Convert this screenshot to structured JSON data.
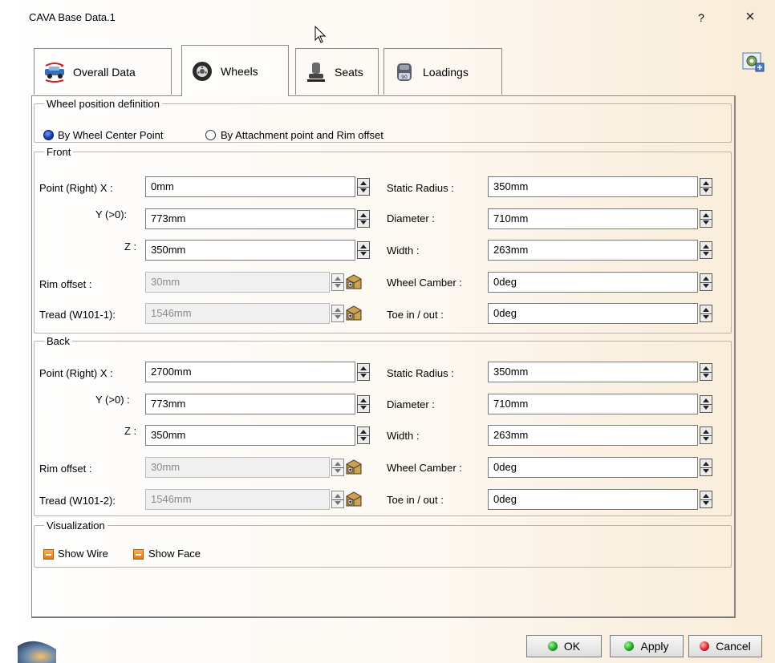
{
  "window": {
    "title": "CAVA Base Data.1",
    "help": "?",
    "close": "×"
  },
  "tabs": [
    {
      "label": "Overall Data",
      "icon": "car-icon"
    },
    {
      "label": "Wheels",
      "icon": "wheel-icon"
    },
    {
      "label": "Seats",
      "icon": "seat-icon"
    },
    {
      "label": "Loadings",
      "icon": "loading-icon"
    }
  ],
  "active_tab": "Wheels",
  "wheel_position": {
    "legend": "Wheel position definition",
    "option1": "By Wheel Center Point",
    "option2": "By Attachment point and Rim offset",
    "selected": "By Wheel Center Point"
  },
  "front": {
    "legend": "Front",
    "labels": {
      "point_x": "Point (Right)  X :",
      "y": "Y (>0):",
      "z": "Z :",
      "rim_offset": "Rim offset :",
      "tread": "Tread (W101-1):",
      "static_radius": "Static Radius :",
      "diameter": "Diameter :",
      "width": "Width :",
      "camber": "Wheel Camber :",
      "toe": "Toe in / out :"
    },
    "values": {
      "x": "0mm",
      "y": "773mm",
      "z": "350mm",
      "rim_offset": "30mm",
      "tread": "1546mm",
      "static_radius": "350mm",
      "diameter": "710mm",
      "width": "263mm",
      "camber": "0deg",
      "toe": "0deg"
    }
  },
  "back": {
    "legend": "Back",
    "labels": {
      "point_x": "Point (Right)  X :",
      "y": "Y (>0) :",
      "z": "Z :",
      "rim_offset": "Rim offset :",
      "tread": "Tread (W101-2):",
      "static_radius": "Static Radius :",
      "diameter": "Diameter :",
      "width": "Width :",
      "camber": "Wheel Camber :",
      "toe": "Toe in / out :"
    },
    "values": {
      "x": "2700mm",
      "y": "773mm",
      "z": "350mm",
      "rim_offset": "30mm",
      "tread": "1546mm",
      "static_radius": "350mm",
      "diameter": "710mm",
      "width": "263mm",
      "camber": "0deg",
      "toe": "0deg"
    }
  },
  "visualization": {
    "legend": "Visualization",
    "show_wire": "Show Wire",
    "show_face": "Show Face",
    "show_wire_checked": true,
    "show_face_checked": true
  },
  "buttons": {
    "ok": "OK",
    "apply": "Apply",
    "cancel": "Cancel"
  }
}
